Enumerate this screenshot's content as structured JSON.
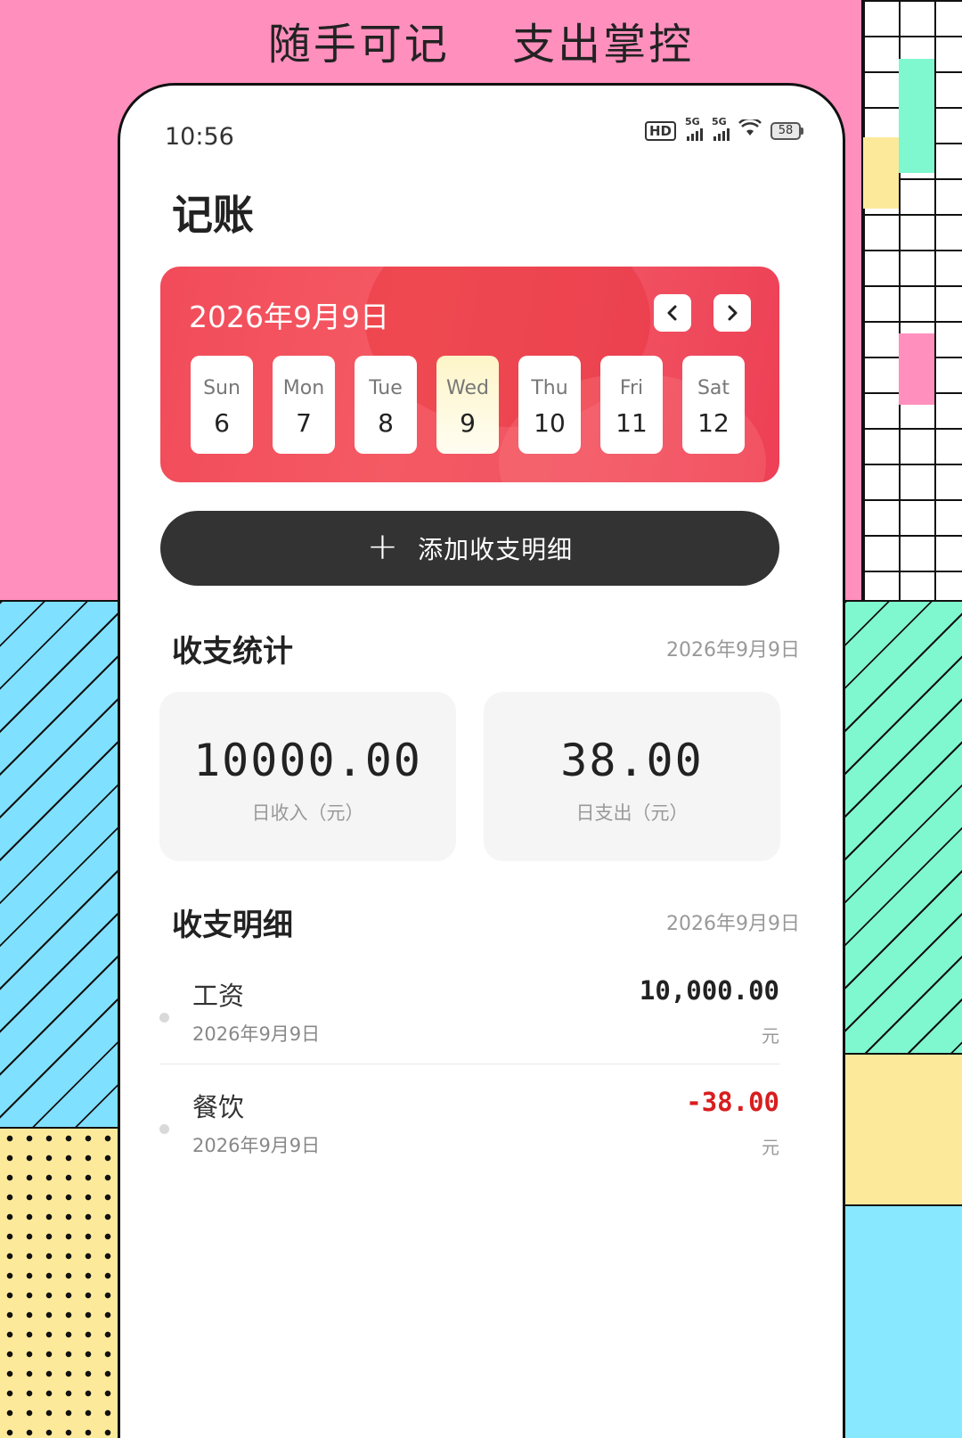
{
  "promo": {
    "left": "随手可记",
    "right": "支出掌控"
  },
  "status_bar": {
    "time": "10:56",
    "net1": "5G",
    "net2": "5G",
    "hd": "HD",
    "battery": "58"
  },
  "page": {
    "title": "记账"
  },
  "calendar": {
    "current_date": "2026年9月9日",
    "days": [
      {
        "name": "Sun",
        "num": "6"
      },
      {
        "name": "Mon",
        "num": "7"
      },
      {
        "name": "Tue",
        "num": "8"
      },
      {
        "name": "Wed",
        "num": "9",
        "selected": true
      },
      {
        "name": "Thu",
        "num": "10"
      },
      {
        "name": "Fri",
        "num": "11"
      },
      {
        "name": "Sat",
        "num": "12"
      }
    ]
  },
  "add_button": {
    "label": "添加收支明细"
  },
  "stats": {
    "title": "收支统计",
    "date": "2026年9月9日",
    "income": {
      "amount": "10000.00",
      "caption": "日收入（元）"
    },
    "expense": {
      "amount": "38.00",
      "caption": "日支出（元）"
    }
  },
  "details": {
    "title": "收支明细",
    "date": "2026年9月9日",
    "records": [
      {
        "name": "工资",
        "date": "2026年9月9日",
        "amount": "10,000.00",
        "unit": "元"
      },
      {
        "name": "餐饮",
        "date": "2026年9月9日",
        "amount": "-38.00",
        "unit": "元"
      }
    ]
  },
  "colors": {
    "accent_red": "#f24b5a",
    "negative": "#d81e1e",
    "button_dark": "#333333"
  }
}
